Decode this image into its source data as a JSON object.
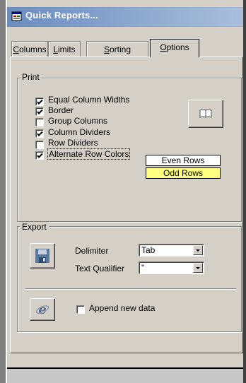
{
  "window": {
    "title": "Quick Reports..."
  },
  "tabs": [
    {
      "label": "Columns",
      "accel": "C",
      "rest": "olumns"
    },
    {
      "label": "Limits",
      "accel": "L",
      "rest": "imits"
    },
    {
      "label": "Sorting",
      "accel": "S",
      "rest": "orting"
    },
    {
      "label": "Options",
      "accel": "O",
      "rest": "ptions",
      "active": true
    }
  ],
  "print": {
    "group_label": "Print",
    "options": [
      {
        "label": "Equal Column Widths",
        "checked": true
      },
      {
        "label": "Border",
        "checked": true
      },
      {
        "label": "Group Columns",
        "checked": false
      },
      {
        "label": "Column Dividers",
        "checked": true
      },
      {
        "label": "Row Dividers",
        "checked": false
      },
      {
        "label": "Alternate Row Colors",
        "checked": true
      }
    ],
    "even_rows_label": "Even Rows",
    "odd_rows_label": "Odd Rows",
    "even_rows_color": "#ffffff",
    "odd_rows_color": "#ffff80",
    "preview_icon": "book-icon"
  },
  "export": {
    "group_label": "Export",
    "delimiter_label": "Delimiter",
    "delimiter_value": "Tab",
    "qualifier_label": "Text Qualifier",
    "qualifier_value": "\"",
    "save_icon": "floppy-disk-icon",
    "browser_icon": "internet-explorer-icon",
    "append_label": "Append new data",
    "append_checked": false
  }
}
